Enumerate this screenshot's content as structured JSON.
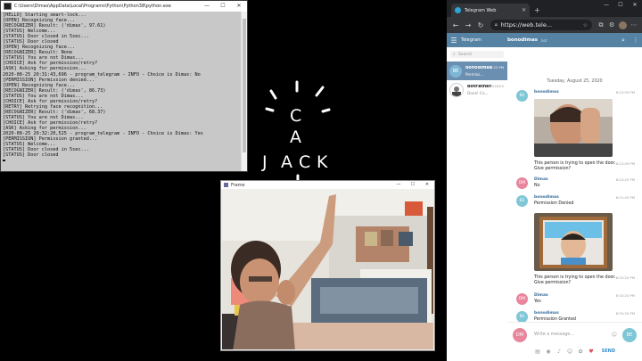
{
  "console": {
    "title": "C:\\Users\\Dimas\\AppData\\Local\\Programs\\Python\\Python38\\python.exe",
    "lines": [
      "[HELLO] Starting smart-lock...",
      "[OPEN] Recognizing face...",
      "[RECOGNIZER] Result: ('dimas', 97.61)",
      "[STATUS] Welcome...",
      "[STATUS] Door closed in 5sec...",
      "[STATUS] Door closed",
      "[OPEN] Recognizing face...",
      "[RECOGNIZER] Result: None",
      "[STATUS] You are not Dimas...",
      "[CHOICE] Ask for permission/retry?",
      "[ASK] Asking for permission...",
      "2020-08-25 20:31:43,696 - program_telegram - INFO - Choice is Dimas: No",
      "[PERMISSION] Permission denied...",
      "[OPEN] Recognizing face...",
      "[RECOGNIZER] Result: ('dimas', 86.73)",
      "[STATUS] You are not Dimas...",
      "[CHOICE] Ask for permission/retry?",
      "[RETRY] Retrying face recognition...",
      "[RECOGNIZER] Result: ('dimas', 68.37)",
      "[STATUS] You are not Dimas...",
      "[CHOICE] Ask for permission/retry?",
      "[ASK] Asking for permission...",
      "2020-08-25 20:32:20,525 - program_telegram - INFO - Choice is Dimas: Yes",
      "[PERMISSION] Permission granted...",
      "[STATUS] Welcome...",
      "[STATUS] Door closed in 5sec...",
      "[STATUS] Door closed"
    ]
  },
  "doodle": {
    "letters": [
      "C",
      "A",
      "J",
      "A",
      "C",
      "K"
    ]
  },
  "frame_window": {
    "title": "Frame"
  },
  "browser": {
    "tab_title": "Telegram Web",
    "url": "https://web.tele...",
    "colors": {
      "tabbar": "#202124",
      "telegram_header": "#5682a3"
    }
  },
  "telegram": {
    "brand": "Telegram",
    "chat_name": "bonodimas",
    "chat_status": "bot",
    "search_placeholder": "Search",
    "dialogs": [
      {
        "avatar": "BE",
        "name": "bonodimas",
        "preview": "Permiss...",
        "time": "8:22 PM"
      },
      {
        "avatar": "",
        "name": "BotFather",
        "preview": "Done! Co...",
        "time": "8/16/20"
      }
    ],
    "date_separator": "Tuesday, August 25, 2020",
    "messages": [
      {
        "sender": "bonodimas",
        "time": "8:22:09 PM"
      },
      {
        "text": "This person is trying to open the door.",
        "text2": "Give permission?",
        "time": "8:22:09 PM"
      },
      {
        "avatar": "DM",
        "sender": "Dimas",
        "text": "No",
        "time": "8:22:43 PM"
      },
      {
        "avatar": "BE",
        "sender": "bonodimas",
        "text": "Permission Denied",
        "time": "8:31:43 PM"
      },
      {
        "text": "This person is trying to open the door.",
        "text2": "Give permission?",
        "time": "8:32:20 PM"
      },
      {
        "avatar": "DM",
        "sender": "Dimas",
        "text": "Yes",
        "time": "8:32:20 PM"
      },
      {
        "avatar": "BE",
        "sender": "bonodimas",
        "text": "Permission Granted",
        "time": "8:32:20 PM"
      }
    ],
    "compose": {
      "me_avatar": "DM",
      "peer_avatar": "BE",
      "placeholder": "Write a message...",
      "send_label": "SEND"
    }
  }
}
